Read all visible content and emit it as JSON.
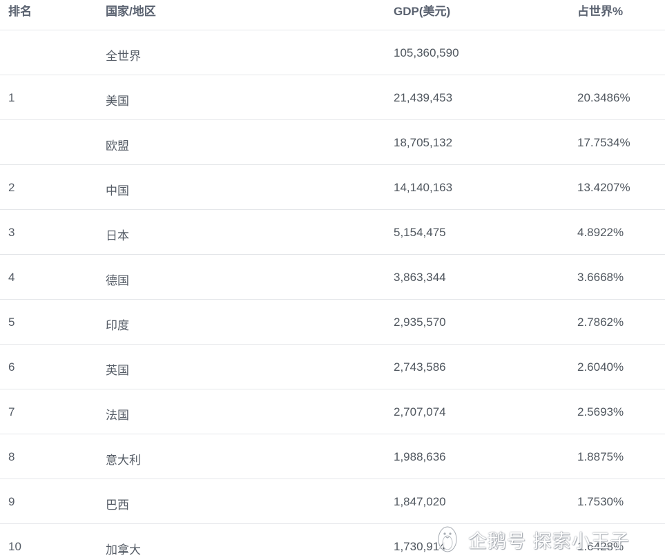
{
  "header": {
    "rank": "排名",
    "name": "国家/地区",
    "gdp": "GDP(美元)",
    "pct": "占世界%"
  },
  "rows": [
    {
      "rank": "",
      "name": "全世界",
      "gdp": "105,360,590",
      "pct": ""
    },
    {
      "rank": "1",
      "name": "美国",
      "gdp": "21,439,453",
      "pct": "20.3486%"
    },
    {
      "rank": "",
      "name": "欧盟",
      "gdp": "18,705,132",
      "pct": "17.7534%"
    },
    {
      "rank": "2",
      "name": "中国",
      "gdp": "14,140,163",
      "pct": "13.4207%"
    },
    {
      "rank": "3",
      "name": "日本",
      "gdp": "5,154,475",
      "pct": "4.8922%"
    },
    {
      "rank": "4",
      "name": "德国",
      "gdp": "3,863,344",
      "pct": "3.6668%"
    },
    {
      "rank": "5",
      "name": "印度",
      "gdp": "2,935,570",
      "pct": "2.7862%"
    },
    {
      "rank": "6",
      "name": "英国",
      "gdp": "2,743,586",
      "pct": "2.6040%"
    },
    {
      "rank": "7",
      "name": "法国",
      "gdp": "2,707,074",
      "pct": "2.5693%"
    },
    {
      "rank": "8",
      "name": "意大利",
      "gdp": "1,988,636",
      "pct": "1.8875%"
    },
    {
      "rank": "9",
      "name": "巴西",
      "gdp": "1,847,020",
      "pct": "1.7530%"
    },
    {
      "rank": "10",
      "name": "加拿大",
      "gdp": "1,730,914",
      "pct": "1.6428%"
    }
  ],
  "watermark": {
    "text": "企鹅号 探索小王子",
    "icon": "penguin-logo-icon"
  }
}
